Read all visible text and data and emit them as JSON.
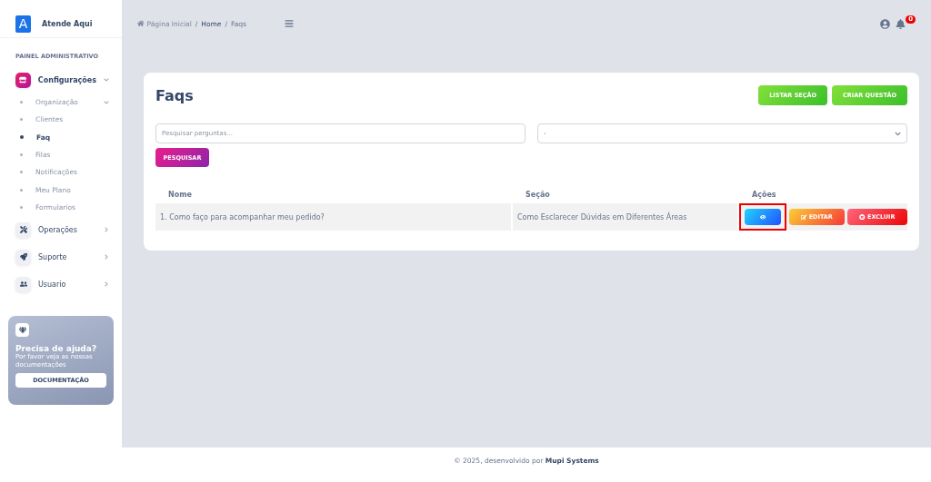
{
  "brand": {
    "logo_letter": "A",
    "name": "Atende Aqui"
  },
  "sidebar": {
    "section_title": "PAINEL ADMINISTRATIVO",
    "groups": [
      {
        "label": "Configurações",
        "expanded": true,
        "selected": true,
        "children": [
          {
            "label": "Organização",
            "selected": false,
            "has_caret": true
          },
          {
            "label": "Clientes",
            "selected": false,
            "has_caret": false
          },
          {
            "label": "Faq",
            "selected": true,
            "has_caret": false
          },
          {
            "label": "Filas",
            "selected": false,
            "has_caret": false
          },
          {
            "label": "Notificações",
            "selected": false,
            "has_caret": false
          },
          {
            "label": "Meu Plano",
            "selected": false,
            "has_caret": false
          },
          {
            "label": "Formularios",
            "selected": false,
            "has_caret": false
          }
        ]
      },
      {
        "label": "Operações",
        "expanded": false,
        "selected": false
      },
      {
        "label": "Suporte",
        "expanded": false,
        "selected": false
      },
      {
        "label": "Usuario",
        "expanded": false,
        "selected": false
      }
    ],
    "help_card": {
      "title": "Precisa de ajuda?",
      "text": "Por favor veja as nossas documentações",
      "button": "DOCUMENTAÇÃO"
    }
  },
  "breadcrumb": [
    {
      "label": "Página Inicial",
      "current": false
    },
    {
      "separator": "/",
      "label": "Home",
      "current": false
    },
    {
      "separator": "/",
      "label": "Faqs",
      "current": true
    }
  ],
  "notifications": {
    "count": "0"
  },
  "page": {
    "title": "Faqs",
    "buttons": [
      "LISTAR SEÇÃO",
      "CRIAR QUESTÃO"
    ],
    "search": {
      "placeholder": "Pesquisar perguntas..."
    },
    "section_select": {
      "value": "-"
    },
    "search_button": "PESQUISAR",
    "table": {
      "columns": [
        "Nome",
        "Seção",
        "Ações"
      ],
      "rows": [
        {
          "cells": [
            "1. Como faço para acompanhar meu pedido?",
            "Como Esclarecer Dúvidas em Diferentes Áreas"
          ],
          "actions": [
            {
              "kind": "view",
              "highlighted": true
            },
            {
              "kind": "edit",
              "label": "EDITAR",
              "highlighted": false
            },
            {
              "kind": "delete",
              "label": "EXCLUIR",
              "highlighted": false
            }
          ]
        }
      ]
    }
  },
  "footer": "© 2025, desenvolvido por **Mupi Systems**"
}
